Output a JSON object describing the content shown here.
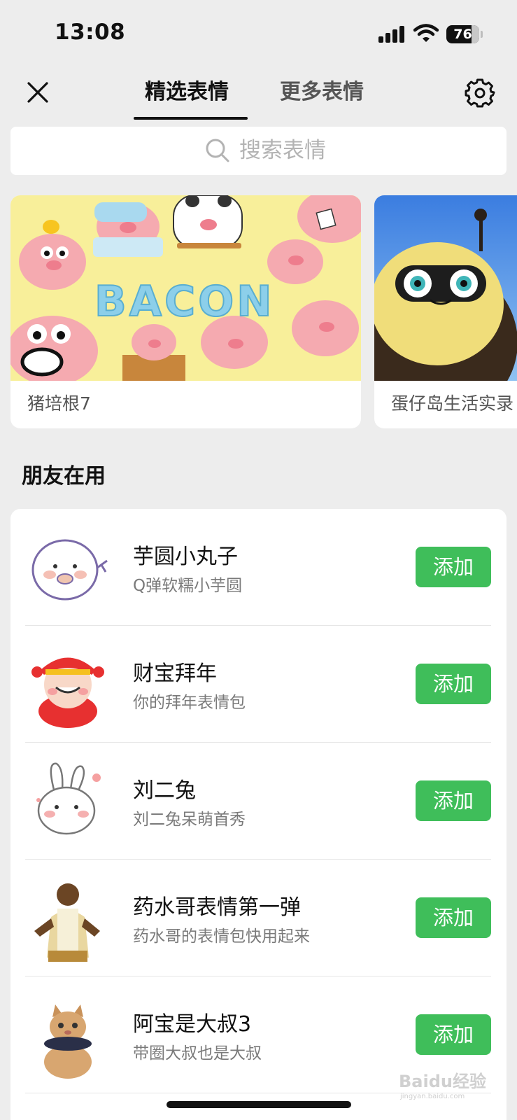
{
  "status_bar": {
    "time": "13:08",
    "battery": "76",
    "battery_level": 0.76
  },
  "nav": {
    "tabs": [
      {
        "label": "精选表情",
        "selected": true
      },
      {
        "label": "更多表情",
        "selected": false
      }
    ],
    "close_icon": "close-icon",
    "settings_icon": "gear-icon"
  },
  "search": {
    "placeholder": "搜索表情"
  },
  "banners": [
    {
      "title": "猪培根7",
      "art_text": "BACON"
    },
    {
      "title": "蛋仔岛生活实录"
    }
  ],
  "friends_section": {
    "title": "朋友在用",
    "items": [
      {
        "title": "芋圆小丸子",
        "subtitle": "Q弹软糯小芋圆",
        "button": "添加"
      },
      {
        "title": "财宝拜年",
        "subtitle": "你的拜年表情包",
        "button": "添加"
      },
      {
        "title": "刘二兔",
        "subtitle": "刘二兔呆萌首秀",
        "button": "添加"
      },
      {
        "title": "药水哥表情第一弹",
        "subtitle": "药水哥的表情包快用起来",
        "button": "添加"
      },
      {
        "title": "阿宝是大叔3",
        "subtitle": "带圈大叔也是大叔",
        "button": "添加"
      }
    ]
  },
  "watermark": {
    "text": "Baidu经验",
    "subtext": "jingyan.baidu.com"
  },
  "colors": {
    "accent_green": "#3fbe5a",
    "background": "#ededed"
  }
}
